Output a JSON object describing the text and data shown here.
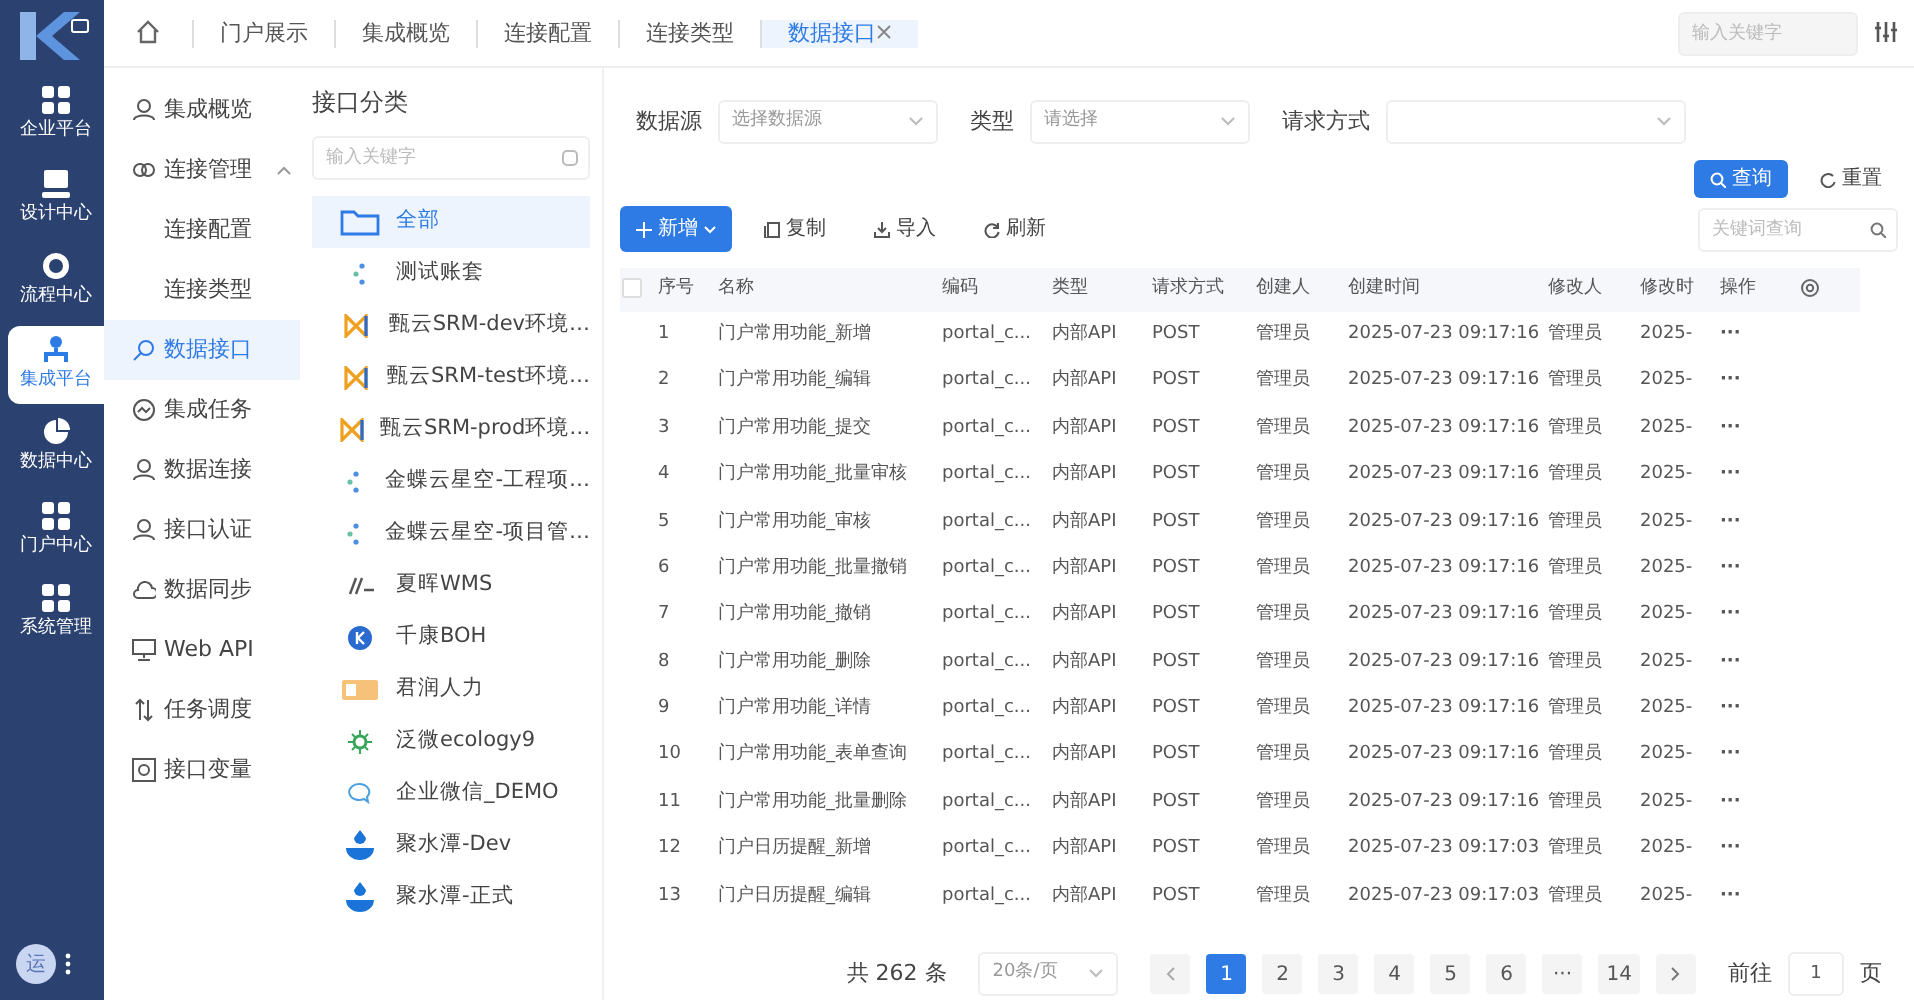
{
  "rail": {
    "items": [
      {
        "label": "企业平台",
        "selected": false
      },
      {
        "label": "设计中心",
        "selected": false
      },
      {
        "label": "流程中心",
        "selected": false
      },
      {
        "label": "集成平台",
        "selected": true
      },
      {
        "label": "数据中心",
        "selected": false
      },
      {
        "label": "门户中心",
        "selected": false
      },
      {
        "label": "系统管理",
        "selected": false
      }
    ],
    "avatar": "运"
  },
  "tabs": [
    {
      "label": "门户展示",
      "selected": false,
      "closable": false
    },
    {
      "label": "集成概览",
      "selected": false,
      "closable": false
    },
    {
      "label": "连接配置",
      "selected": false,
      "closable": false
    },
    {
      "label": "连接类型",
      "selected": false,
      "closable": false
    },
    {
      "label": "数据接口",
      "selected": true,
      "closable": true
    }
  ],
  "top_search": {
    "placeholder": "输入关键字"
  },
  "menu": [
    {
      "label": "集成概览",
      "selected": false
    },
    {
      "label": "连接管理",
      "selected": false,
      "expanded": true,
      "children": [
        {
          "label": "连接配置",
          "selected": false
        },
        {
          "label": "连接类型",
          "selected": false
        }
      ]
    },
    {
      "label": "数据接口",
      "selected": true
    },
    {
      "label": "集成任务",
      "selected": false
    },
    {
      "label": "数据连接",
      "selected": false
    },
    {
      "label": "接口认证",
      "selected": false
    },
    {
      "label": "数据同步",
      "selected": false
    },
    {
      "label": "Web API",
      "selected": false
    },
    {
      "label": "任务调度",
      "selected": false
    },
    {
      "label": "接口变量",
      "selected": false
    }
  ],
  "categories": {
    "title": "接口分类",
    "search": {
      "placeholder": "输入关键字"
    },
    "items": [
      {
        "label": "全部",
        "selected": true
      },
      {
        "label": "测试账套",
        "selected": false
      },
      {
        "label": "甄云SRM-dev环境…",
        "selected": false
      },
      {
        "label": "甄云SRM-test环境…",
        "selected": false
      },
      {
        "label": "甄云SRM-prod环境…",
        "selected": false
      },
      {
        "label": "金蝶云星空-工程项…",
        "selected": false
      },
      {
        "label": "金蝶云星空-项目管…",
        "selected": false
      },
      {
        "label": "夏晖WMS",
        "selected": false
      },
      {
        "label": "千康BOH",
        "selected": false
      },
      {
        "label": "君润人力",
        "selected": false
      },
      {
        "label": "泛微ecology9",
        "selected": false
      },
      {
        "label": "企业微信_DEMO",
        "selected": false
      },
      {
        "label": "聚水潭-Dev",
        "selected": false
      },
      {
        "label": "聚水潭-正式",
        "selected": false
      }
    ]
  },
  "filters": [
    {
      "label": "数据源",
      "placeholder": "选择数据源"
    },
    {
      "label": "类型",
      "placeholder": "请选择"
    },
    {
      "label": "请求方式"
    }
  ],
  "filter_buttons": [
    {
      "label": "查询",
      "kind": "primary"
    },
    {
      "label": "重置",
      "kind": "link"
    }
  ],
  "toolbar": [
    {
      "label": "新增",
      "kind": "primary"
    },
    {
      "label": "复制",
      "kind": "copy"
    },
    {
      "label": "导入",
      "kind": "import"
    },
    {
      "label": "刷新",
      "kind": "refresh"
    }
  ],
  "keyword_search": {
    "placeholder": "关键词查询"
  },
  "table": {
    "select_all_checked": false,
    "columns": [
      "序号",
      "名称",
      "编码",
      "类型",
      "请求方式",
      "创建人",
      "创建时间",
      "修改人",
      "修改时",
      "操作"
    ],
    "rows": [
      [
        "1",
        "门户常用功能_新增",
        "portal_c...",
        "内部API",
        "POST",
        "管理员",
        "2025-07-23 09:17:16",
        "管理员",
        "2025-",
        "···"
      ],
      [
        "2",
        "门户常用功能_编辑",
        "portal_c...",
        "内部API",
        "POST",
        "管理员",
        "2025-07-23 09:17:16",
        "管理员",
        "2025-",
        "···"
      ],
      [
        "3",
        "门户常用功能_提交",
        "portal_c...",
        "内部API",
        "POST",
        "管理员",
        "2025-07-23 09:17:16",
        "管理员",
        "2025-",
        "···"
      ],
      [
        "4",
        "门户常用功能_批量审核",
        "portal_c...",
        "内部API",
        "POST",
        "管理员",
        "2025-07-23 09:17:16",
        "管理员",
        "2025-",
        "···"
      ],
      [
        "5",
        "门户常用功能_审核",
        "portal_c...",
        "内部API",
        "POST",
        "管理员",
        "2025-07-23 09:17:16",
        "管理员",
        "2025-",
        "···"
      ],
      [
        "6",
        "门户常用功能_批量撤销",
        "portal_c...",
        "内部API",
        "POST",
        "管理员",
        "2025-07-23 09:17:16",
        "管理员",
        "2025-",
        "···"
      ],
      [
        "7",
        "门户常用功能_撤销",
        "portal_c...",
        "内部API",
        "POST",
        "管理员",
        "2025-07-23 09:17:16",
        "管理员",
        "2025-",
        "···"
      ],
      [
        "8",
        "门户常用功能_删除",
        "portal_c...",
        "内部API",
        "POST",
        "管理员",
        "2025-07-23 09:17:16",
        "管理员",
        "2025-",
        "···"
      ],
      [
        "9",
        "门户常用功能_详情",
        "portal_c...",
        "内部API",
        "POST",
        "管理员",
        "2025-07-23 09:17:16",
        "管理员",
        "2025-",
        "···"
      ],
      [
        "10",
        "门户常用功能_表单查询",
        "portal_c...",
        "内部API",
        "POST",
        "管理员",
        "2025-07-23 09:17:16",
        "管理员",
        "2025-",
        "···"
      ],
      [
        "11",
        "门户常用功能_批量删除",
        "portal_c...",
        "内部API",
        "POST",
        "管理员",
        "2025-07-23 09:17:16",
        "管理员",
        "2025-",
        "···"
      ],
      [
        "12",
        "门户日历提醒_新增",
        "portal_c...",
        "内部API",
        "POST",
        "管理员",
        "2025-07-23 09:17:03",
        "管理员",
        "2025-",
        "···"
      ],
      [
        "13",
        "门户日历提醒_编辑",
        "portal_c...",
        "内部API",
        "POST",
        "管理员",
        "2025-07-23 09:17:03",
        "管理员",
        "2025-",
        "···"
      ]
    ]
  },
  "pagination": {
    "total": "共 262 条",
    "page_size": "20条/页",
    "pages": [
      {
        "label": "1",
        "selected": true
      },
      {
        "label": "2",
        "selected": false
      },
      {
        "label": "3",
        "selected": false
      },
      {
        "label": "4",
        "selected": false
      },
      {
        "label": "5",
        "selected": false
      },
      {
        "label": "6",
        "selected": false
      },
      {
        "label": "···",
        "selected": false
      },
      {
        "label": "14",
        "selected": false
      }
    ],
    "goto_label": "前往",
    "goto_value": "1",
    "page_unit": "页"
  }
}
